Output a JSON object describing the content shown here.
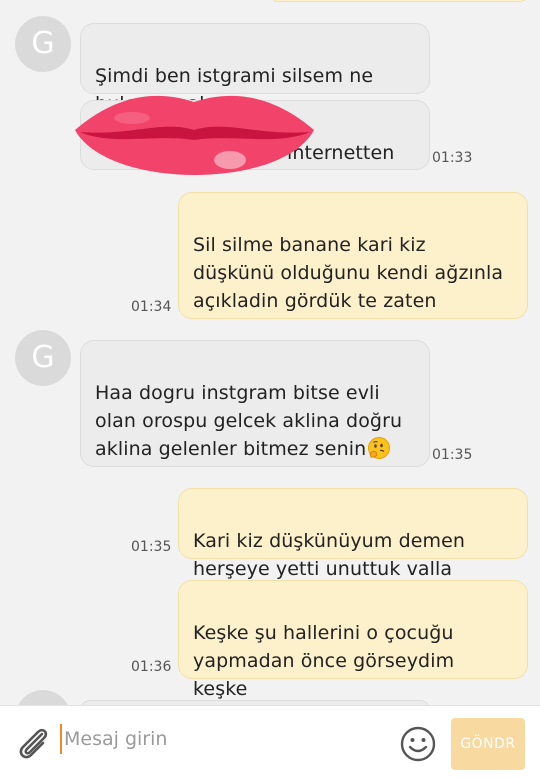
{
  "messages": [
    {
      "side": "in",
      "avatar_letter": "G",
      "text": "Şimdi ben istgrami silsem ne bulcan acaba",
      "time": ""
    },
    {
      "side": "in",
      "avatar_letter": "",
      "text": "internetten",
      "time": "01:33"
    },
    {
      "side": "out",
      "text": "Sil silme banane kari kiz düşkünü olduğunu kendi ağzınla açıkladin gördük te zaten",
      "time": "01:34"
    },
    {
      "side": "in",
      "avatar_letter": "G",
      "text": "Haa dogru instgram bitse evli olan orospu gelcek aklina doğru aklina gelenler bitmez senin",
      "time": "01:35"
    },
    {
      "side": "out",
      "text": "Kari kiz düşkünüyum demen herşeye yetti unuttuk valla",
      "time": "01:35"
    },
    {
      "side": "out",
      "text": "Keşke şu hallerini o çocuğu yapmadan önce görseydim keşke",
      "time": "01:36"
    }
  ],
  "input": {
    "placeholder": "Mesaj girin",
    "value": ""
  },
  "send_label": "GÖNDR",
  "icons": {
    "attach": "paperclip-icon",
    "emoji": "smiley-icon",
    "redaction": "lips-sticker-icon",
    "thinking": "thinking-face-emoji"
  },
  "colors": {
    "incoming_bubble": "#ececec",
    "outgoing_bubble": "#fdf1cc",
    "accent": "#f08a24",
    "send_button": "#f8d9a0"
  }
}
